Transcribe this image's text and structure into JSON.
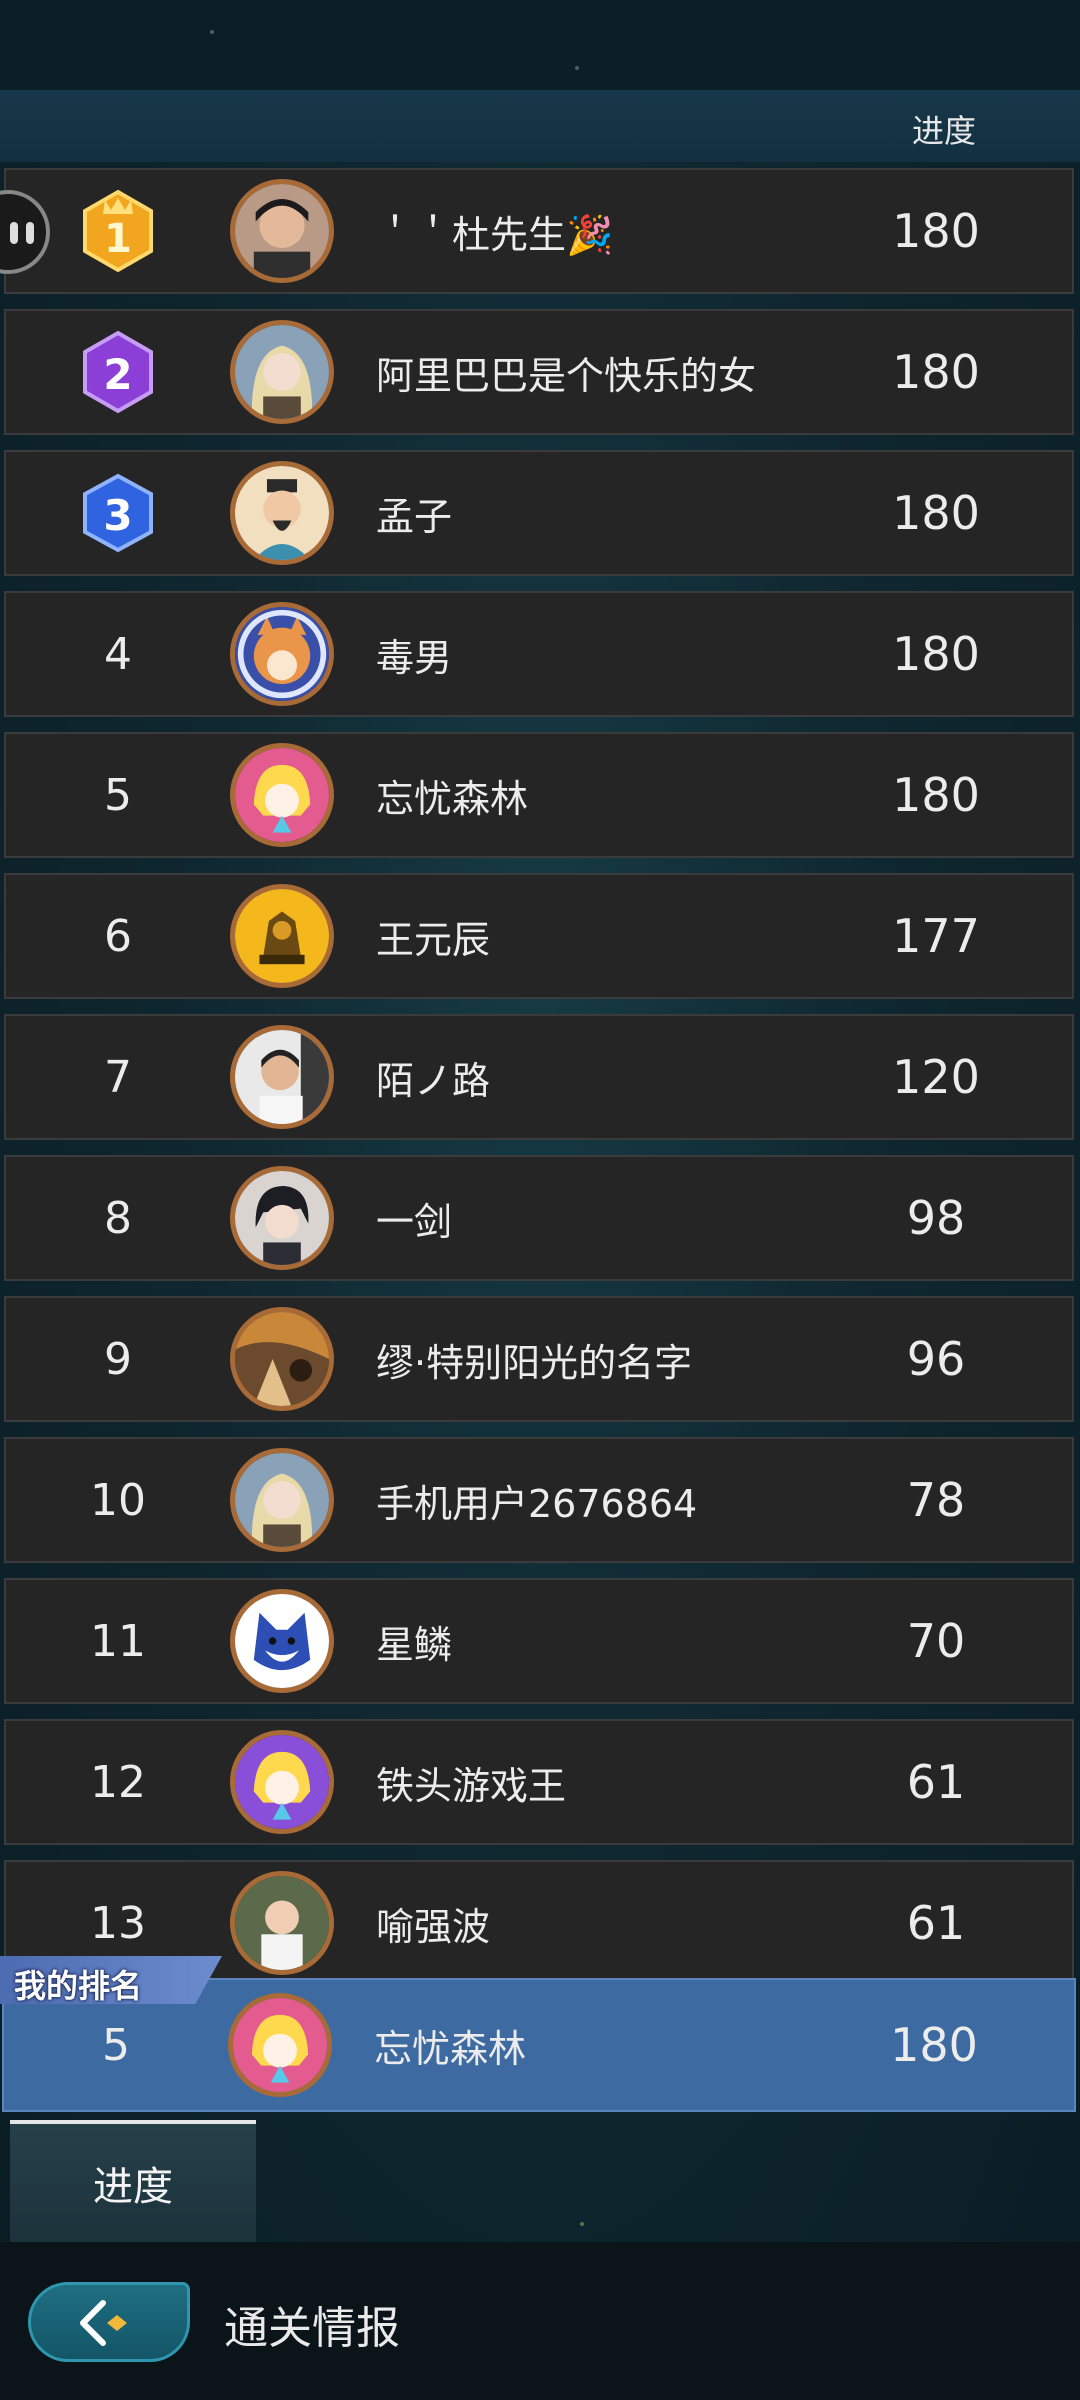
{
  "header": {
    "column_label": "进度"
  },
  "rows": [
    {
      "rank": "",
      "badge": "gold-1",
      "name": "＇＇杜先生🎉",
      "score": "180",
      "avatar": "photo-young-man"
    },
    {
      "rank": "",
      "badge": "purple-2",
      "name": "阿里巴巴是个快乐的女",
      "score": "180",
      "avatar": "anime-girl-blonde"
    },
    {
      "rank": "",
      "badge": "blue-3",
      "name": "孟子",
      "score": "180",
      "avatar": "ancient-scholar"
    },
    {
      "rank": "4",
      "name": "毒男",
      "score": "180",
      "avatar": "shiba-dog"
    },
    {
      "rank": "5",
      "name": "忘忧森林",
      "score": "180",
      "avatar": "cartoon-girl-pink"
    },
    {
      "rank": "6",
      "name": "王元辰",
      "score": "177",
      "avatar": "golden-knight"
    },
    {
      "rank": "7",
      "name": "陌ノ路",
      "score": "120",
      "avatar": "photo-man"
    },
    {
      "rank": "8",
      "name": "一剑",
      "score": "98",
      "avatar": "anime-boy"
    },
    {
      "rank": "9",
      "name": "缪·特别阳光的名字",
      "score": "96",
      "avatar": "painting"
    },
    {
      "rank": "10",
      "name": "手机用户2676864",
      "score": "78",
      "avatar": "anime-girl-blonde"
    },
    {
      "rank": "11",
      "name": "星鳞",
      "score": "70",
      "avatar": "cartoon-wolf"
    },
    {
      "rank": "12",
      "name": "铁头游戏王",
      "score": "61",
      "avatar": "cartoon-girl-purple"
    },
    {
      "rank": "13",
      "name": "喻强波",
      "score": "61",
      "avatar": "photo-baby"
    }
  ],
  "my_rank": {
    "tag": "我的排名",
    "rank": "5",
    "name": "忘忧森林",
    "score": "180",
    "avatar": "cartoon-girl-pink"
  },
  "tabs": [
    {
      "label": "进度",
      "active": true
    }
  ],
  "footer": {
    "title": "通关情报",
    "back_icon": "back-arrow-icon"
  },
  "colors": {
    "row_bg": "#252525",
    "my_row_bg": "#3d6aa0",
    "avatar_border": "#a86a36",
    "back_button": "#1f6e82"
  }
}
